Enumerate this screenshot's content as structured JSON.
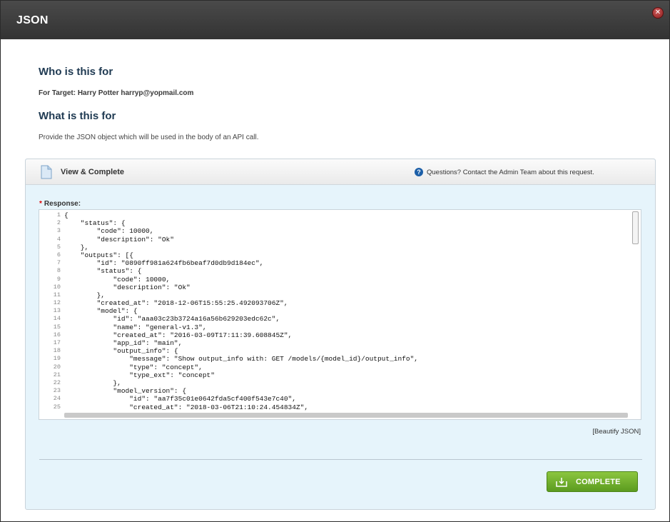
{
  "window": {
    "title": "JSON",
    "close_icon": "close-icon"
  },
  "who": {
    "heading": "Who is this for",
    "target_text": "For Target: Harry Potter harryp@yopmail.com"
  },
  "what": {
    "heading": "What is this for",
    "description": "Provide the JSON object which will be used in the body of an API call."
  },
  "panel": {
    "title": "View & Complete",
    "help_text": "Questions? Contact the Admin Team about this request.",
    "help_icon": "question-icon",
    "doc_icon": "document-icon"
  },
  "response": {
    "required_mark": "*",
    "label": "Response:",
    "lines": [
      "{",
      "    \"status\": {",
      "        \"code\": 10000,",
      "        \"description\": \"Ok\"",
      "    },",
      "    \"outputs\": [{",
      "        \"id\": \"0890ff981a624fb6beaf7d0db9d184ec\",",
      "        \"status\": {",
      "            \"code\": 10000,",
      "            \"description\": \"Ok\"",
      "        },",
      "        \"created_at\": \"2018-12-06T15:55:25.492093706Z\",",
      "        \"model\": {",
      "            \"id\": \"aaa03c23b3724a16a56b629203edc62c\",",
      "            \"name\": \"general-v1.3\",",
      "            \"created_at\": \"2016-03-09T17:11:39.608845Z\",",
      "            \"app_id\": \"main\",",
      "            \"output_info\": {",
      "                \"message\": \"Show output_info with: GET /models/{model_id}/output_info\",",
      "                \"type\": \"concept\",",
      "                \"type_ext\": \"concept\"",
      "            },",
      "            \"model_version\": {",
      "                \"id\": \"aa7f35c01e0642fda5cf400f543e7c40\",",
      "                \"created_at\": \"2018-03-06T21:10:24.454834Z\","
    ]
  },
  "actions": {
    "beautify_label": "[Beautify JSON]",
    "complete_label": "COMPLETE",
    "complete_icon": "download-tray-icon"
  },
  "colors": {
    "titlebar": "#3a3a3a",
    "panel_bg": "#e6f4fb",
    "heading": "#1f3a52",
    "complete_button": "#6fae2b",
    "required": "#dd0000"
  }
}
